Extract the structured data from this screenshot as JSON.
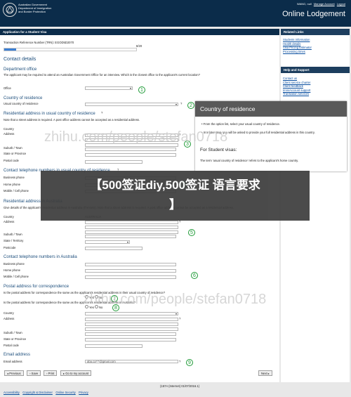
{
  "header": {
    "dept_lines": [
      "Australian Government",
      "Department of Immigration",
      "and Border Protection"
    ],
    "user": "WANG, null",
    "manage_account": "Manage Account",
    "logout": "Logout",
    "app_title": "Online Lodgement"
  },
  "form": {
    "title": "Application for a Student Visa",
    "trn_label": "Transaction Reference Number (TRN): EGOD5D2070",
    "page_count": "8/20",
    "progress_fraction": 0.09,
    "section_title": "Contact details",
    "dept_office": {
      "heading": "Department office",
      "desc": "The applicant may be required to attend an Australian Government Office for an interview. Which is the closest office to the applicant's current location?",
      "office_label": "Office"
    },
    "residence_country": {
      "heading": "Country of residence",
      "label": "Usual country of residence"
    },
    "residential_address": {
      "heading": "Residential address in usual country of residence",
      "note": "Note that a street address is required. A post office address cannot be accepted as a residential address.",
      "country_label": "Country",
      "address_label": "Address",
      "suburb_label": "Suburb / Town",
      "state_label": "State or Province",
      "postcode_label": "Postal code"
    },
    "phone_residence": {
      "heading": "Contact telephone numbers in usual country of residence",
      "business_label": "Business phone",
      "home_label": "Home phone",
      "mobile_label": "Mobile / Cell phone"
    },
    "address_australia": {
      "heading": "Residential address in Australia",
      "desc": "Give details of the applicant's residential address in Australia (if known). Note that a street address is required. A post office address cannot be accepted as a residential address.",
      "country_label": "Country",
      "country_value": "AUSTRALIA",
      "address_label": "Address",
      "suburb_label": "Suburb / Town",
      "state_label": "State / Territory",
      "postcode_label": "Postcode"
    },
    "phone_australia": {
      "heading": "Contact telephone numbers in Australia",
      "business_label": "Business phone",
      "home_label": "Home phone",
      "mobile_label": "Mobile / Cell phone"
    },
    "postal": {
      "heading": "Postal address for correspondence",
      "q1": "Is the postal address for correspondence the same as the applicant's residential address in their usual country of residence?",
      "q2": "Is the postal address for correspondence the same as the applicant's residential address in Australia?",
      "yes": "Yes",
      "no": "No",
      "country_label": "Country",
      "address_label": "Address",
      "suburb_label": "Suburb / Town",
      "state_label": "State or Province",
      "postcode_label": "Postal code"
    },
    "email": {
      "heading": "Email address",
      "label": "Email address",
      "value": "aba.ca***@gmail.com"
    },
    "buttons": {
      "previous": "Previous",
      "save": "Save",
      "print": "Print",
      "goto": "Go to my account",
      "next": "Next"
    },
    "markers": [
      "1",
      "2",
      "3",
      "4",
      "5",
      "6",
      "7",
      "8",
      "9"
    ]
  },
  "sidebar": {
    "related_links_title": "Related Links",
    "related_links": [
      "Students information",
      "Health details",
      "Visa Pricing Estimator",
      "Processing times"
    ],
    "help_title": "Help and Support",
    "help_links": [
      "Contact us",
      "Client service charter",
      "Client feedback",
      "ImmiAccount support",
      "Translation services"
    ]
  },
  "tooltip_panel": {
    "title": "Country of residence",
    "bullets": [
      "From the option list, select your usual country of residence.",
      "In a later step, you will be asked to provide your full residential address in this country."
    ],
    "subheading": "For Student visas:",
    "body": "The term 'usual country of residence' refers to the applicant's home country."
  },
  "watermarks": [
    "zhihu.com/people/stefan0718",
    "zhihu.com/people/stefan0718"
  ],
  "banner": {
    "line1": "【500签证diy,500签证 语言要求",
    "line2": "】"
  },
  "footer": {
    "links": [
      "Accessibility",
      "Copyright & Disclaimer",
      "Online Security",
      "Privacy"
    ],
    "version": "(157A (Internet) 01/07/2016.1)"
  }
}
